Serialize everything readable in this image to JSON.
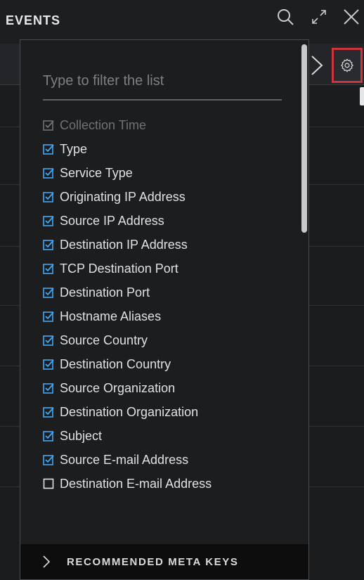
{
  "header": {
    "title": "EVENTS",
    "icons": [
      "search-icon",
      "expand-icon",
      "close-icon"
    ]
  },
  "column_selector": {
    "filter_placeholder": "Type to filter the list",
    "colors": {
      "checked": "#3fa9f5",
      "disabled": "#6f7276",
      "highlight_border": "#d0343a"
    },
    "items": [
      {
        "label": "Collection Time",
        "checked": true,
        "disabled": true
      },
      {
        "label": "Type",
        "checked": true,
        "disabled": false
      },
      {
        "label": "Service Type",
        "checked": true,
        "disabled": false
      },
      {
        "label": "Originating IP Address",
        "checked": true,
        "disabled": false
      },
      {
        "label": "Source IP Address",
        "checked": true,
        "disabled": false
      },
      {
        "label": "Destination IP Address",
        "checked": true,
        "disabled": false
      },
      {
        "label": "TCP Destination Port",
        "checked": true,
        "disabled": false
      },
      {
        "label": "Destination Port",
        "checked": true,
        "disabled": false
      },
      {
        "label": "Hostname Aliases",
        "checked": true,
        "disabled": false
      },
      {
        "label": "Source Country",
        "checked": true,
        "disabled": false
      },
      {
        "label": "Destination Country",
        "checked": true,
        "disabled": false
      },
      {
        "label": "Source Organization",
        "checked": true,
        "disabled": false
      },
      {
        "label": "Destination Organization",
        "checked": true,
        "disabled": false
      },
      {
        "label": "Subject",
        "checked": true,
        "disabled": false
      },
      {
        "label": "Source E-mail Address",
        "checked": true,
        "disabled": false
      },
      {
        "label": "Destination E-mail Address",
        "checked": false,
        "disabled": false
      }
    ],
    "footer_label": "RECOMMENDED META KEYS"
  }
}
